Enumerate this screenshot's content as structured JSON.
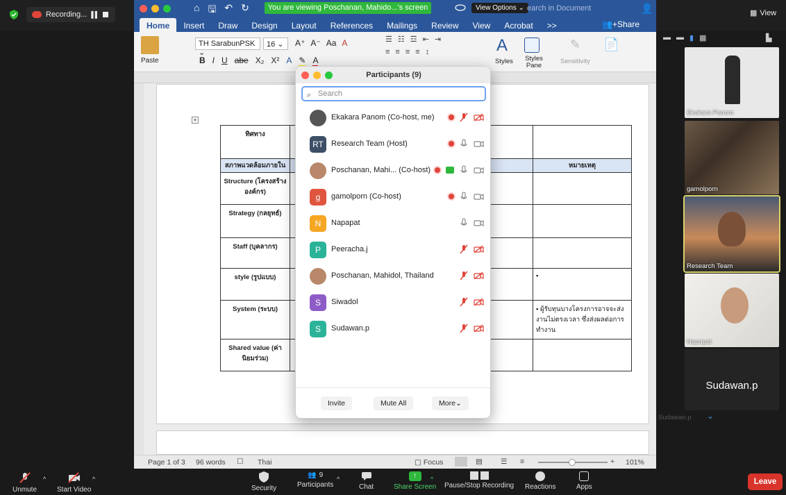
{
  "zoom": {
    "recording_label": "Recording...",
    "view_label": "View",
    "share_banner": "You are viewing Poschanan, Mahido...'s screen",
    "view_options": "View Options",
    "toolbar": {
      "unmute": "Unmute",
      "start_video": "Start Video",
      "security": "Security",
      "participants": "Participants",
      "participant_count": "9",
      "chat": "Chat",
      "share_screen": "Share Screen",
      "pause_recording": "Pause/Stop Recording",
      "reactions": "Reactions",
      "apps": "Apps",
      "leave": "Leave"
    }
  },
  "word": {
    "search_placeholder": "earch in Document",
    "tabs": [
      "Home",
      "Insert",
      "Draw",
      "Design",
      "Layout",
      "References",
      "Mailings",
      "Review",
      "View",
      "Acrobat",
      ">>"
    ],
    "share": "Share",
    "font_name": "TH SarabunPSK",
    "font_size": "16",
    "paste": "Paste",
    "styles": "Styles",
    "styles_pane": "Styles Pane",
    "sensitivity": "Sensitivity",
    "status": {
      "page": "Page 1 of 3",
      "words": "96 words",
      "language": "Thai",
      "focus": "Focus",
      "zoom": "101%"
    },
    "table": {
      "direction_header": "ทิศทาง",
      "env_header": "สภาพแวดล้อมภายใน",
      "notes_header": "หมายเหตุ",
      "rows": [
        {
          "label": "Structure (โครงสร้างองค์กร)",
          "note": ""
        },
        {
          "label": "Strategy (กลยุทธ์)",
          "note": ""
        },
        {
          "label": "Staff (บุคลากร)",
          "note": ""
        },
        {
          "label": "style (รูปแบบ)",
          "note": "▪"
        },
        {
          "label": "System (ระบบ)",
          "note": "▪  ผู้รับทุนบางโครงการอาจจะส่งงานไม่ตรงเวลา ซึ่งส่งผลต่อการทำงาน"
        },
        {
          "label": "Shared value (ค่านิยมร่วม)",
          "note": ""
        }
      ]
    }
  },
  "participants": {
    "title": "Participants (9)",
    "search_placeholder": "Search",
    "list": [
      {
        "name": "Ekakara Panom (Co-host, me)",
        "initials": "",
        "color": "#555555",
        "mic": "muted",
        "video": "off",
        "rec": true
      },
      {
        "name": "Research Team (Host)",
        "initials": "RT",
        "color": "#3d4f66",
        "mic": "on",
        "video": "on",
        "rec": true
      },
      {
        "name": "Poschanan, Mahi...  (Co-host)",
        "initials": "",
        "color": "#b9876a",
        "mic": "on",
        "video": "on",
        "rec": true,
        "sharing": true
      },
      {
        "name": "gamolporn (Co-host)",
        "initials": "g",
        "color": "#e0553e",
        "mic": "on",
        "video": "on",
        "rec": true
      },
      {
        "name": "Napapat",
        "initials": "N",
        "color": "#f5a623",
        "mic": "on",
        "video": "on",
        "rec": false
      },
      {
        "name": "Peeracha.j",
        "initials": "P",
        "color": "#2bb39a",
        "mic": "muted",
        "video": "off",
        "rec": false
      },
      {
        "name": "Poschanan, Mahidol, Thailand",
        "initials": "",
        "color": "#b9876a",
        "mic": "muted",
        "video": "off",
        "rec": false
      },
      {
        "name": "Siwadol",
        "initials": "S",
        "color": "#8e5cc7",
        "mic": "muted",
        "video": "off",
        "rec": false
      },
      {
        "name": "Sudawan.p",
        "initials": "S",
        "color": "#2bb39a",
        "mic": "muted",
        "video": "off",
        "rec": false
      }
    ],
    "buttons": {
      "invite": "Invite",
      "mute_all": "Mute All",
      "more": "More"
    }
  },
  "gallery": {
    "tiles": [
      "Ekakara Panom",
      "gamolporn",
      "Research Team",
      "Napapat",
      "Sudawan.p"
    ],
    "faded": "Sudawan.p"
  }
}
